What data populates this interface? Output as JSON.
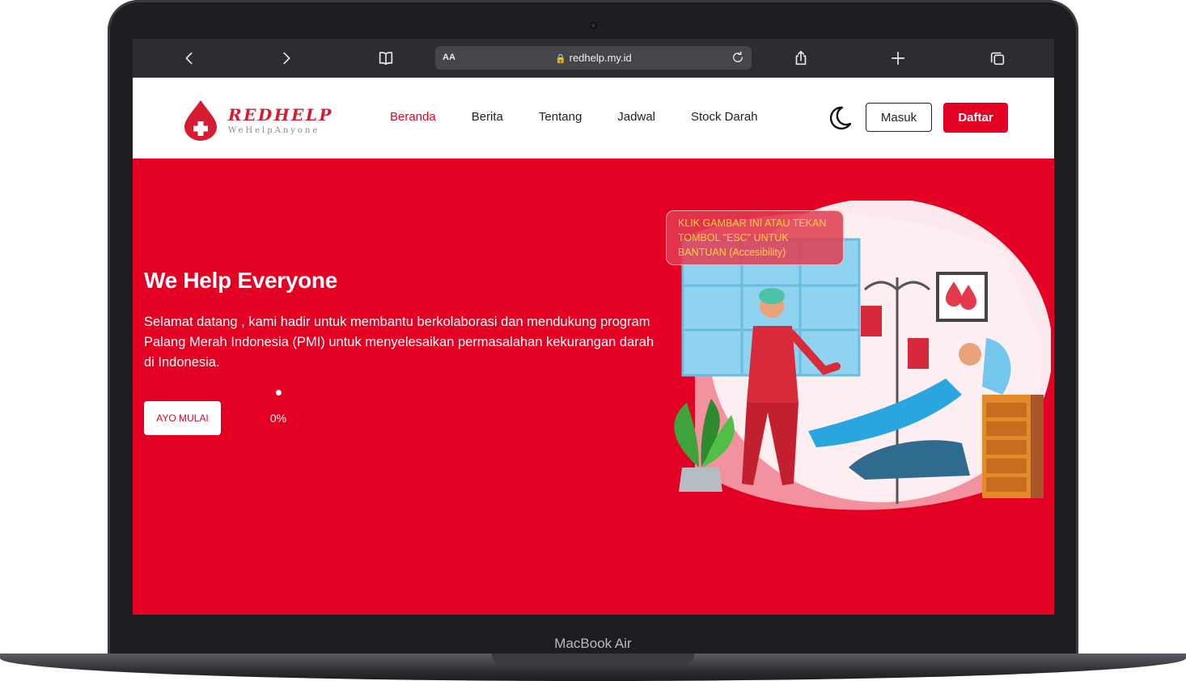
{
  "device": {
    "label": "MacBook Air"
  },
  "browser": {
    "aa_label": "AA",
    "url": "redhelp.my.id"
  },
  "site": {
    "logo": {
      "title": "REDHELP",
      "subtitle": "WeHelpAnyone"
    },
    "nav": [
      {
        "label": "Beranda",
        "active": true
      },
      {
        "label": "Berita",
        "active": false
      },
      {
        "label": "Tentang",
        "active": false
      },
      {
        "label": "Jadwal",
        "active": false
      },
      {
        "label": "Stock Darah",
        "active": false
      }
    ],
    "masuk_label": "Masuk",
    "daftar_label": "Daftar"
  },
  "hero": {
    "title": "We Help Everyone",
    "description": "Selamat datang , kami hadir untuk membantu berkolaborasi dan mendukung program Palang Merah Indonesia (PMI) untuk menyelesaikan permasalahan kekurangan darah di Indonesia.",
    "cta_label": "AYO MULAI",
    "progress_text": "0%",
    "tooltip": "KLIK GAMBAR INI ATAU TEKAN TOMBOL \"ESC\" UNTUK BANTUAN (Accesibility)"
  },
  "colors": {
    "brand_red": "#e30022",
    "tooltip_text": "#ffd23f",
    "toolbar": "#2b2d31"
  },
  "icons": [
    "back-icon",
    "forward-icon",
    "bookmarks-icon",
    "lock-icon",
    "reload-icon",
    "share-icon",
    "new-tab-icon",
    "tabs-icon",
    "blood-drop-logo-icon",
    "moon-icon"
  ]
}
